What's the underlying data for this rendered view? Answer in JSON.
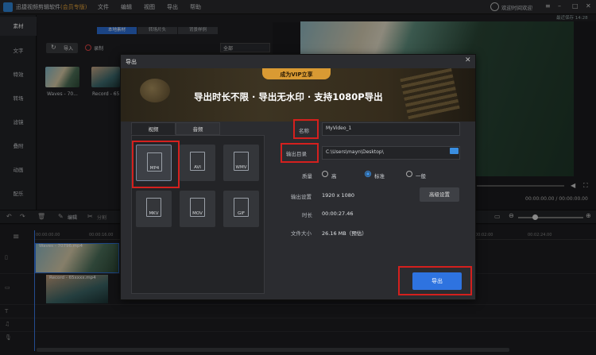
{
  "app": {
    "title": "迅捷视频剪辑软件",
    "edition": "(会员专版)",
    "menu": [
      "文件",
      "编辑",
      "视图",
      "导出",
      "帮助"
    ],
    "user": "欢迎时间欢迎",
    "version": "最近保存 14:28"
  },
  "sidebar": {
    "items": [
      "素材",
      "文字",
      "特效",
      "转场",
      "滤镜",
      "叠附",
      "动画",
      "配乐"
    ]
  },
  "media": {
    "tabs": [
      "本地素材",
      "转场片头",
      "背景样例"
    ],
    "import_label": "导入",
    "record_label": "录制",
    "filter": "全部",
    "items": [
      "Waves - 70...",
      "Record - 65..."
    ]
  },
  "preview": {
    "time": "00:00:00.00 / 00:00:00.00"
  },
  "toolbar": {
    "edit_label": "编辑",
    "split_label": "分割"
  },
  "timeline": {
    "ticks": [
      "00:00:00.00",
      "00:00:16.00",
      "00:02:00",
      "00:02:24.00"
    ],
    "clips": [
      "Waves - 70796.mp4",
      "Record - 65xxxx.mp4"
    ]
  },
  "dialog": {
    "title": "导出",
    "banner_pill": "成为VIP立享",
    "banner_text": "导出时长不限 · 导出无水印 · 支持1080P导出",
    "tabs": [
      "视频",
      "音频"
    ],
    "formats": [
      "MP4",
      "AVI",
      "WMV",
      "MKV",
      "MOV",
      "GIF"
    ],
    "selected_format": "MP4",
    "name_label": "名称",
    "name_value": "MyVideo_1",
    "dir_label": "输出目录",
    "dir_value": "C:\\Users\\mayn\\Desktop\\",
    "quality_label": "质量",
    "quality_options": [
      "高",
      "标准",
      "一般"
    ],
    "quality_selected": "标准",
    "settings_label": "输出设置",
    "settings_value": "1920 x 1080",
    "adv_button": "高级设置",
    "duration_label": "时长",
    "duration_value": "00:00:27.46",
    "size_label": "文件大小",
    "size_value": "26.16 MB（预估）",
    "export_button": "导出"
  }
}
